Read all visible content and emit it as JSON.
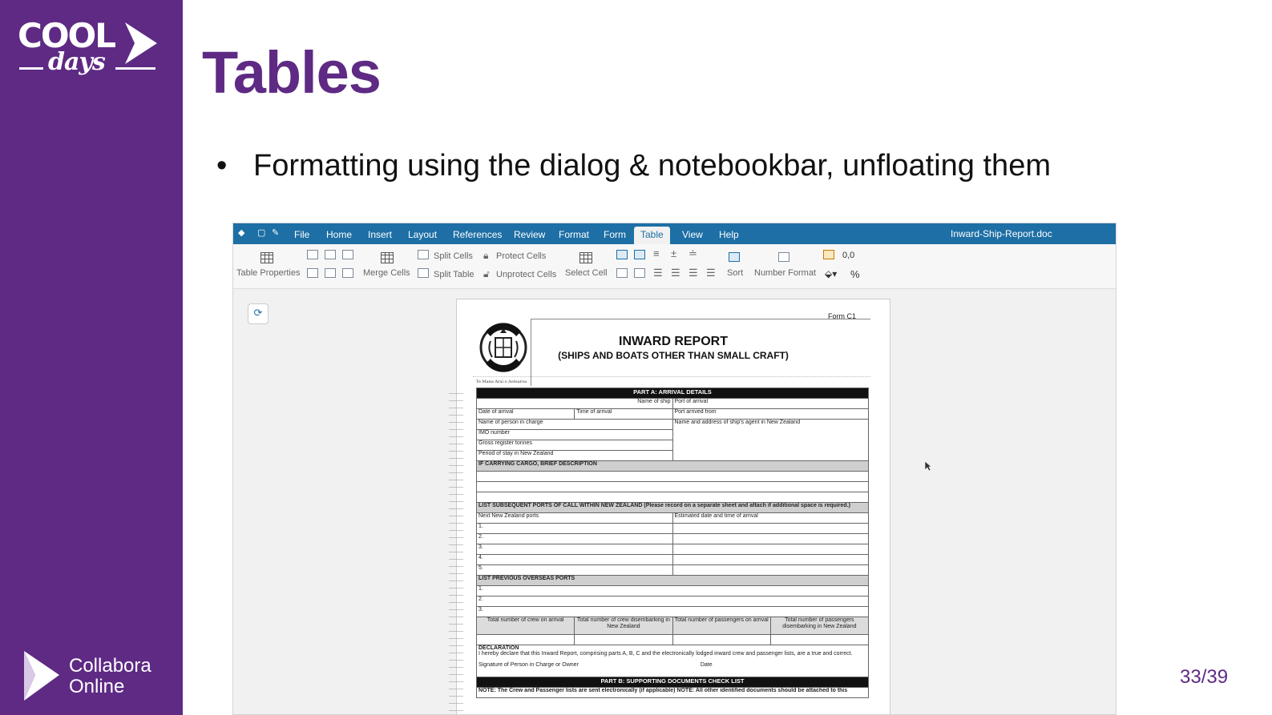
{
  "slide": {
    "title": "Tables",
    "bullet": "Formatting using the dialog & notebookbar, unfloating them",
    "bullet_marker": "•",
    "page_number": "33/39"
  },
  "branding": {
    "cool_logo_word": "COOL",
    "cool_logo_sub": "days",
    "collabora_line1": "Collabora",
    "collabora_line2": "Online",
    "brand_color": "#5e2a84",
    "accent_color": "#1d6fa5"
  },
  "app": {
    "document_name": "Inward-Ship-Report.doc",
    "menus": [
      "File",
      "Home",
      "Insert",
      "Layout",
      "References",
      "Review",
      "Format",
      "Form",
      "Table",
      "View",
      "Help"
    ],
    "active_menu": "Table",
    "ribbon": {
      "table_properties": "Table Properties",
      "merge_cells": "Merge Cells",
      "split_cells": "Split Cells",
      "split_table": "Split Table",
      "protect_cells": "Protect Cells",
      "unprotect_cells": "Unprotect Cells",
      "select_cell": "Select Cell",
      "sort": "Sort",
      "number_format": "Number Format",
      "decimal": "0,0",
      "percent": "%"
    },
    "side_button_icon": "navigator-icon"
  },
  "document": {
    "form_label": "Form C1",
    "title": "INWARD REPORT",
    "subtitle": "(SHIPS AND BOATS OTHER THAN SMALL CRAFT)",
    "crest_caption": "Te Mana Arai o Aotearoa",
    "part_a": "PART A: ARRIVAL DETAILS",
    "name_of_ship": "Name of ship",
    "port_of_arrival": "Port of arrival",
    "date_of_arrival": "Date of arrival",
    "time_of_arrival": "Time of arrival",
    "port_arrived_from": "Port arrived from",
    "person_in_charge": "Name of person in charge",
    "agent": "Name and address of ship's agent in New Zealand",
    "imo": "IMO number",
    "gross_tonnes": "Gross register tonnes",
    "period_of_stay": "Period of stay in New Zealand",
    "cargo": "IF CARRYING CARGO, BRIEF DESCRIPTION",
    "subsequent_ports": "LIST SUBSEQUENT PORTS OF CALL WITHIN NEW ZEALAND (Please record on a separate sheet and attach if additional space is required.)",
    "next_nz_ports": "Next New Zealand ports",
    "est_date_time": "Estimated date and time of arrival",
    "previous_ports": "LIST PREVIOUS OVERSEAS PORTS",
    "row_numbers": [
      "1.",
      "2.",
      "3.",
      "4.",
      "5."
    ],
    "crew_on_arrival": "Total number of crew on arrival",
    "crew_disembarking": "Total number of crew disembarking in New Zealand",
    "passengers_on_arrival": "Total number of passengers on arrival",
    "passengers_disembarking": "Total number of passengers disembarking in New Zealand",
    "declaration": "DECLARATION",
    "declaration_text": "I hereby declare that this Inward Report, comprising parts A, B, C and the electronically lodged inward crew and passenger lists, are a true and correct.",
    "signature": "Signature of Person in Charge or Owner",
    "date": "Date",
    "part_b": "PART B: SUPPORTING DOCUMENTS CHECK LIST",
    "note": "NOTE: The Crew and Passenger lists are sent electronically (if applicable) NOTE: All other identified documents should be attached to this"
  }
}
